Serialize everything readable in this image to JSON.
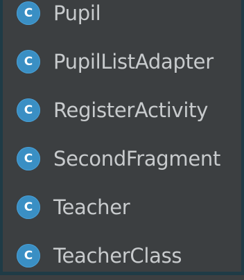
{
  "icon_letter": "C",
  "colors": {
    "background": "#3c3f41",
    "border": "#1f3b46",
    "class_icon": "#3a8fc4",
    "text": "#c8cbcd"
  },
  "tree": {
    "items": [
      {
        "label": "Pupil",
        "icon": "class-icon"
      },
      {
        "label": "PupilListAdapter",
        "icon": "class-icon"
      },
      {
        "label": "RegisterActivity",
        "icon": "class-icon"
      },
      {
        "label": "SecondFragment",
        "icon": "class-icon"
      },
      {
        "label": "Teacher",
        "icon": "class-icon"
      },
      {
        "label": "TeacherClass",
        "icon": "class-icon"
      }
    ]
  }
}
